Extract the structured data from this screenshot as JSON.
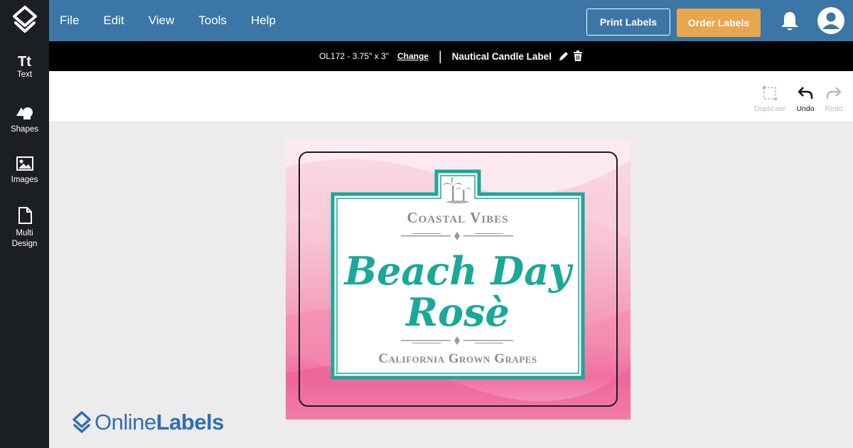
{
  "menu": {
    "items": [
      "File",
      "Edit",
      "View",
      "Tools",
      "Help"
    ]
  },
  "header": {
    "print_label": "Print Labels",
    "order_label": "Order Labels"
  },
  "sidebar": {
    "items": [
      {
        "label": "Text",
        "icon": "text-icon"
      },
      {
        "label": "Shapes",
        "icon": "shapes-icon"
      },
      {
        "label": "Images",
        "icon": "images-icon"
      },
      {
        "label_line1": "Multi",
        "label_line2": "Design",
        "icon": "multi-design-icon"
      }
    ]
  },
  "infobar": {
    "size": "OL172 - 3.75\" x 3\"",
    "change": "Change",
    "separator": "|",
    "design_name": "Nautical Candle Label"
  },
  "toolbar": {
    "duplicate": "Duplicate",
    "undo": "Undo",
    "redo": "Redo"
  },
  "label_design": {
    "top_text": "Coastal Vibes",
    "title_line1": "Beach Day",
    "title_line2": "Rosè",
    "bottom_text": "California Grown Grapes"
  },
  "brand": {
    "name_part1": "Online",
    "name_part2": "Labels"
  },
  "colors": {
    "topbar": "#3b76a6",
    "sidebar": "#1b1f22",
    "order_button": "#e8a64f",
    "teal": "#1aa89a",
    "gray_text": "#8a8a8a",
    "brand_blue": "#2f6fb5"
  }
}
